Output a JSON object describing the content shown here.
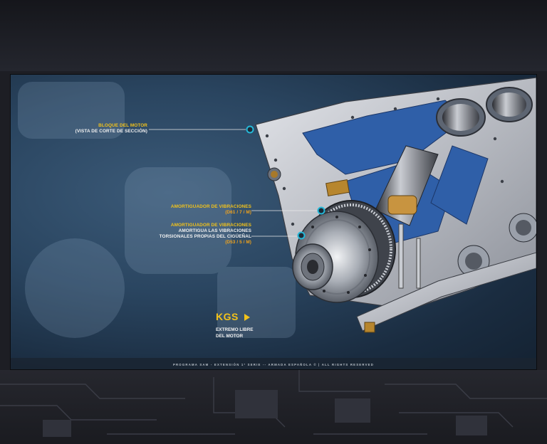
{
  "labels": {
    "block_title": "BLOQUE DEL MOTOR",
    "block_sub": "(VISTA DE CORTE DE SECCIÓN)",
    "damper1_title": "AMORTIGUADOR  DE VIBRACIONES",
    "damper1_code": "(D61 / 7 / M)",
    "damper2_title": "AMORTIGUADOR  DE VIBRACIONES",
    "damper2_desc1": "AMORTIGUA LAS VIBRACIONES",
    "damper2_desc2": "TORSIONALES PROPIAS DEL CIGÜEÑAL",
    "damper2_code": "(D53 / 5 / M)"
  },
  "kgs": {
    "title": "KGS",
    "sub1": "EXTREMO LIBRE",
    "sub2": "DEL MOTOR"
  },
  "footer": "PROGRAMA SAM - EXTENSIÓN 1ª SERIE -- ARMADA ESPAÑOLA © | ALL RIGHTS RESERVED",
  "colors": {
    "accent_yellow": "#f2c21a",
    "accent_orange": "#f0a21b",
    "marker_cyan": "#25b8d8",
    "engine_blue": "#2f5fa8",
    "engine_metal": "#b8bcc4"
  }
}
